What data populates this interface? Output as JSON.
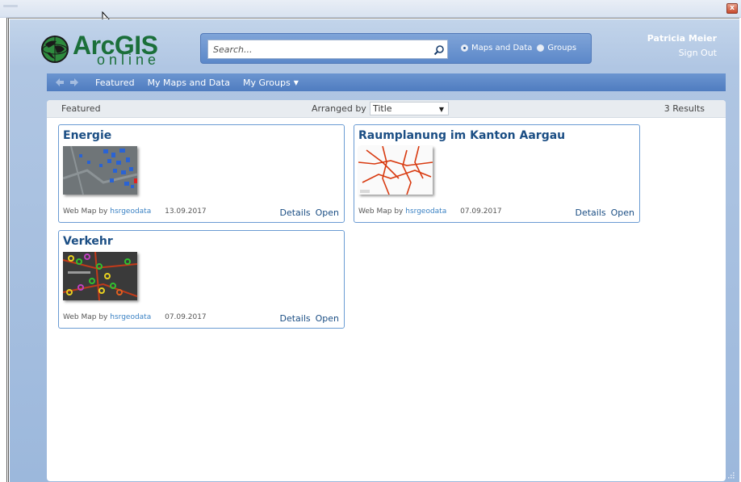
{
  "header": {
    "logo_main": "ArcGIS",
    "logo_sub": "online",
    "search_placeholder": "Search...",
    "radio_maps": "Maps and Data",
    "radio_groups": "Groups",
    "user_name": "Patricia Meier",
    "sign_out": "Sign Out"
  },
  "nav": {
    "items": [
      {
        "label": "Featured"
      },
      {
        "label": "My Maps and Data"
      },
      {
        "label": "My Groups"
      }
    ]
  },
  "panel": {
    "title": "Featured",
    "arranged_label": "Arranged by",
    "sort_value": "Title",
    "results": "3 Results"
  },
  "cards": [
    {
      "title": "Energie",
      "type": "Web Map by",
      "owner": "hsrgeodata",
      "date": "13.09.2017",
      "details": "Details",
      "open": "Open"
    },
    {
      "title": "Raumplanung im Kanton Aargau",
      "type": "Web Map by",
      "owner": "hsrgeodata",
      "date": "07.09.2017",
      "details": "Details",
      "open": "Open"
    },
    {
      "title": "Verkehr",
      "type": "Web Map by",
      "owner": "hsrgeodata",
      "date": "07.09.2017",
      "details": "Details",
      "open": "Open"
    }
  ],
  "colors": {
    "accent": "#4f7cc0",
    "title_blue": "#1b4e84",
    "logo_green": "#1b6f3a"
  }
}
